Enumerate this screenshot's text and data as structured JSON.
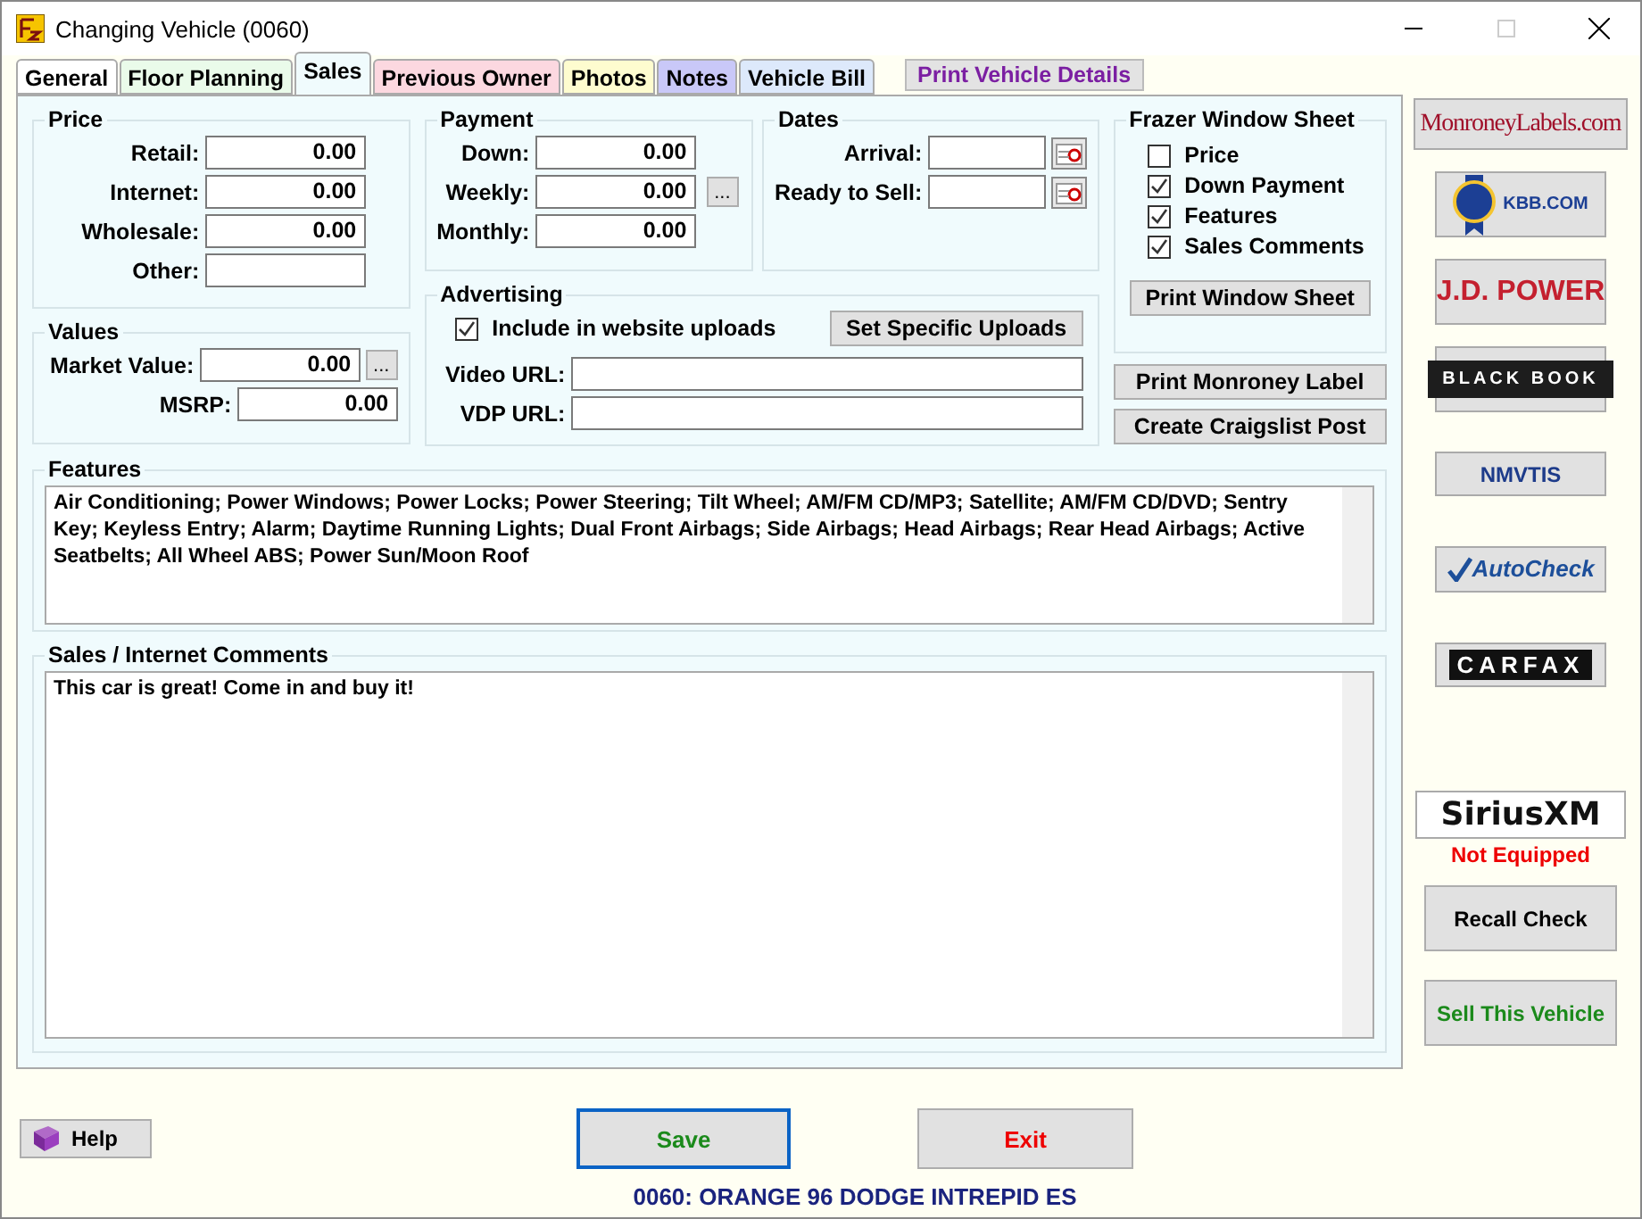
{
  "window": {
    "title": "Changing Vehicle  (0060)"
  },
  "tabs": [
    {
      "label": "General",
      "selected": false,
      "color": "#ffffff"
    },
    {
      "label": "Floor Planning",
      "selected": false,
      "color": "#eafbea"
    },
    {
      "label": "Sales",
      "selected": true,
      "color": "#f0fbfd"
    },
    {
      "label": "Previous Owner",
      "selected": false,
      "color": "#fcd8e0"
    },
    {
      "label": "Photos",
      "selected": false,
      "color": "#fefccf"
    },
    {
      "label": "Notes",
      "selected": false,
      "color": "#c9c8f8"
    },
    {
      "label": "Vehicle Bill",
      "selected": false,
      "color": "#dde9fb"
    }
  ],
  "print_details": "Print Vehicle Details",
  "price": {
    "title": "Price",
    "fields": [
      {
        "label": "Retail:",
        "value": "0.00"
      },
      {
        "label": "Internet:",
        "value": "0.00"
      },
      {
        "label": "Wholesale:",
        "value": "0.00"
      },
      {
        "label": "Other:"
      }
    ]
  },
  "values": {
    "title": "Values",
    "fields": [
      {
        "label": "Market Value:",
        "value": "0.00",
        "more": "..."
      },
      {
        "label": "MSRP:",
        "value": "0.00"
      }
    ]
  },
  "payment": {
    "title": "Payment",
    "fields": [
      {
        "label": "Down:",
        "value": "0.00"
      },
      {
        "label": "Weekly:",
        "value": "0.00"
      },
      {
        "label": "Monthly:",
        "value": "0.00"
      }
    ],
    "more": "..."
  },
  "dates": {
    "title": "Dates",
    "fields": [
      {
        "label": "Arrival:"
      },
      {
        "label": "Ready to Sell:"
      }
    ]
  },
  "advertising": {
    "title": "Advertising",
    "include": {
      "label": "Include in website uploads",
      "checked": true
    },
    "button": "Set Specific Uploads",
    "fields": [
      {
        "label": "Video URL:"
      },
      {
        "label": "VDP URL:"
      }
    ]
  },
  "window_sheet": {
    "title": "Frazer Window Sheet",
    "options": [
      {
        "label": "Price",
        "checked": false
      },
      {
        "label": "Down Payment",
        "checked": true
      },
      {
        "label": "Features",
        "checked": true
      },
      {
        "label": "Sales Comments",
        "checked": true
      }
    ],
    "button": "Print Window Sheet"
  },
  "side_buttons": [
    "Print Monroney Label",
    "Create Craigslist Post"
  ],
  "features": {
    "title": "Features",
    "text": "Air Conditioning; Power Windows; Power Locks; Power Steering; Tilt Wheel; AM/FM CD/MP3; Satellite; AM/FM CD/DVD; Sentry Key; Keyless Entry; Alarm; Daytime Running Lights; Dual Front Airbags; Side Airbags; Head Airbags; Rear Head Airbags; Active Seatbelts; All Wheel ABS; Power Sun/Moon Roof"
  },
  "comments": {
    "title": "Sales / Internet Comments",
    "text": "This car is great! Come in and buy it!"
  },
  "sidebar": {
    "logos": [
      {
        "kind": "monroney",
        "text": "MonroneyLabels.com"
      },
      {
        "kind": "kbb",
        "text": "KBB.COM"
      },
      {
        "kind": "jdpower",
        "text": "J.D. POWER"
      },
      {
        "kind": "blackbook",
        "text": "BLACK BOOK"
      },
      {
        "kind": "nmvtis",
        "text": "NMVTIS"
      },
      {
        "kind": "autocheck",
        "text": "AutoCheck"
      },
      {
        "kind": "carfax",
        "text": "CARFAX"
      },
      {
        "kind": "sirius",
        "text": "SiriusXM"
      }
    ],
    "sirius_status": "Not Equipped",
    "recall": "Recall Check",
    "sell": "Sell This Vehicle"
  },
  "footer": {
    "help": "Help",
    "save": "Save",
    "exit": "Exit",
    "vehicle": "0060: ORANGE 96 DODGE INTREPID ES"
  }
}
